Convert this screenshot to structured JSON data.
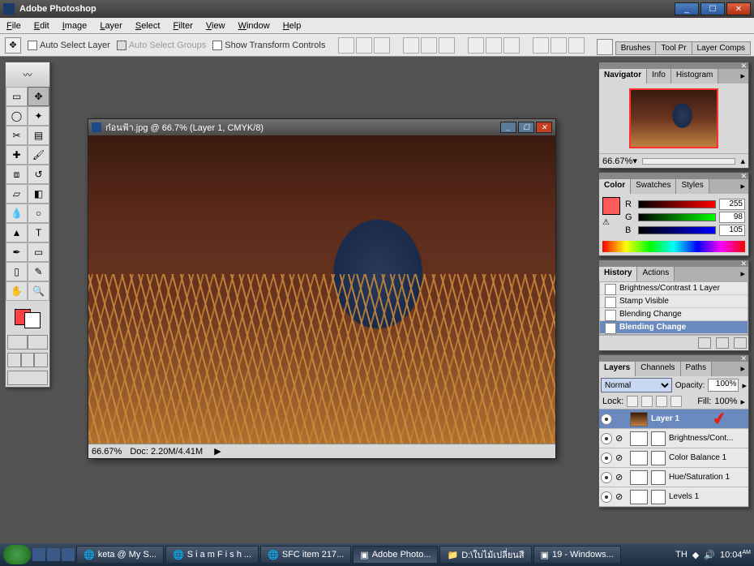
{
  "app": {
    "title": "Adobe Photoshop"
  },
  "menu": [
    "File",
    "Edit",
    "Image",
    "Layer",
    "Select",
    "Filter",
    "View",
    "Window",
    "Help"
  ],
  "options": {
    "auto_select_layer": "Auto Select Layer",
    "auto_select_groups": "Auto Select Groups",
    "show_transform": "Show Transform Controls"
  },
  "palette_tabs": [
    "Brushes",
    "Tool Pr",
    "Layer Comps"
  ],
  "document": {
    "title": "ก๋อนฟ้า.jpg @ 66.7% (Layer 1, CMYK/8)",
    "zoom": "66.67%",
    "doc_size": "Doc: 2.20M/4.41M"
  },
  "navigator": {
    "tabs": [
      "Navigator",
      "Info",
      "Histogram"
    ],
    "zoom": "66.67%"
  },
  "color": {
    "tabs": [
      "Color",
      "Swatches",
      "Styles"
    ],
    "r": "255",
    "g": "98",
    "b": "105"
  },
  "history": {
    "tabs": [
      "History",
      "Actions"
    ],
    "items": [
      "Brightness/Contrast 1 Layer",
      "Stamp Visible",
      "Blending Change",
      "Blending Change"
    ]
  },
  "layers": {
    "tabs": [
      "Layers",
      "Channels",
      "Paths"
    ],
    "blend_mode": "Normal",
    "opacity_label": "Opacity:",
    "opacity": "100%",
    "lock_label": "Lock:",
    "fill_label": "Fill:",
    "fill": "100%",
    "items": [
      {
        "name": "Layer 1"
      },
      {
        "name": "Brightness/Cont..."
      },
      {
        "name": "Color Balance 1"
      },
      {
        "name": "Hue/Saturation 1"
      },
      {
        "name": "Levels 1"
      }
    ]
  },
  "taskbar": {
    "items": [
      "keta @ My S...",
      "S i a m F i s h ...",
      "SFC item 217...",
      "Adobe Photo...",
      "D:\\ใบไม้เปลี่ยนสี",
      "19 - Windows..."
    ],
    "lang": "TH",
    "time": "10:04",
    "ampm": "AM"
  }
}
